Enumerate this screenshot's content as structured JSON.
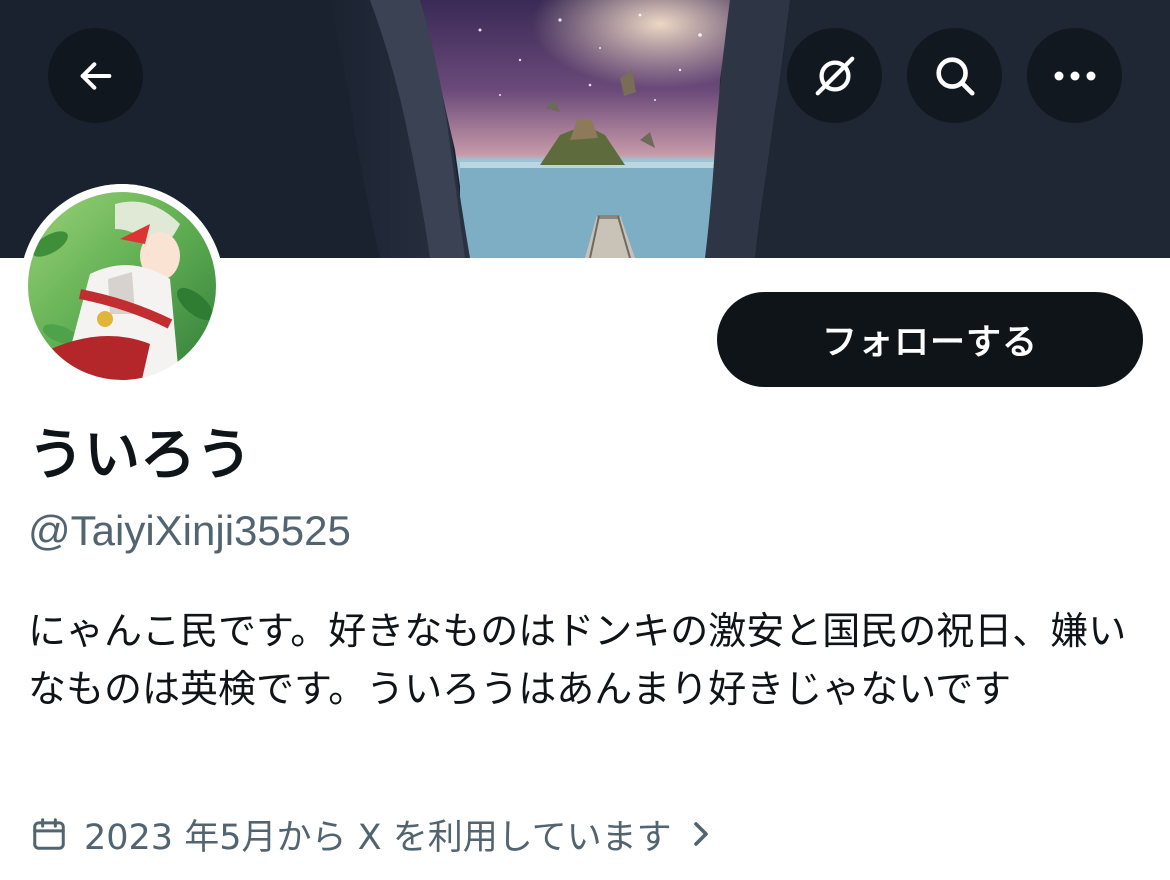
{
  "header": {
    "back_icon": "arrow-left-icon",
    "grok_icon": "grok-icon",
    "search_icon": "search-icon",
    "more_icon": "more-horizontal-icon"
  },
  "profile": {
    "follow_label": "フォローする",
    "display_name": "ういろう",
    "handle": "@TaiyiXinji35525",
    "bio": "にゃんこ民です。好きなものはドンキの激安と国民の祝日、嫌いなものは英検です。ういろうはあんまり好きじゃないです",
    "joined": "2023 年5月から X を利用しています",
    "joined_icon": "calendar-icon",
    "joined_chevron_icon": "chevron-right-icon"
  },
  "colors": {
    "text_primary": "#0f1419",
    "text_secondary": "#536471",
    "button_bg": "#0f1419",
    "button_text": "#ffffff",
    "overlay_button_bg": "rgba(15,20,25,0.78)"
  }
}
